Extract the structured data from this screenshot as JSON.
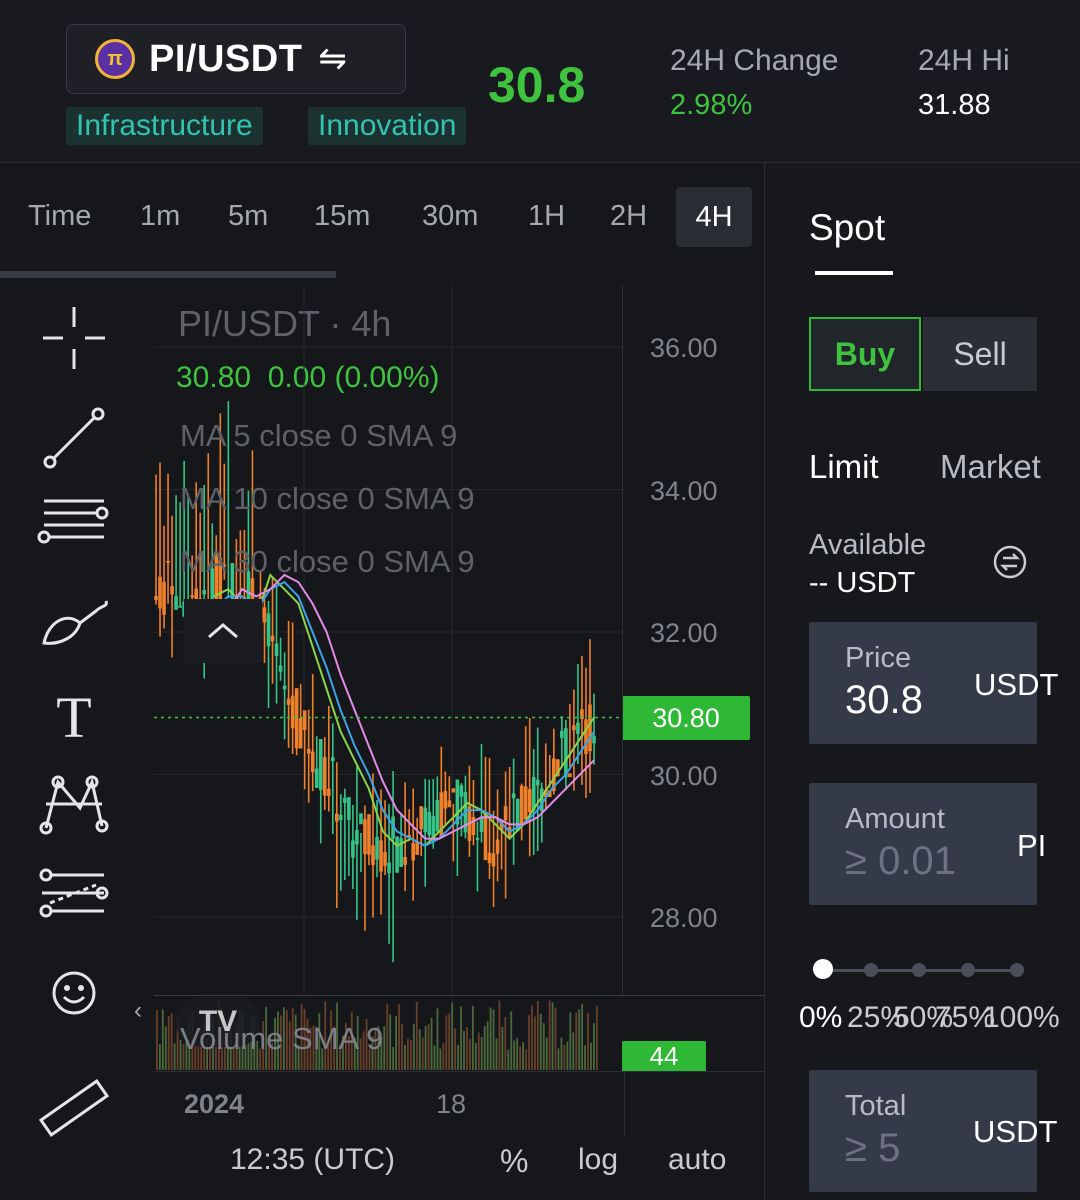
{
  "header": {
    "pair": "PI/USDT",
    "logo_text": "π",
    "swap_icon": "⇋",
    "tags": [
      "Infrastructure",
      "Innovation"
    ],
    "last_price": "30.8",
    "change_label": "24H Change",
    "change_value": "2.98%",
    "high_label": "24H Hi",
    "high_value": "31.88"
  },
  "timeframes": [
    "Time",
    "1m",
    "5m",
    "15m",
    "30m",
    "1H",
    "2H",
    "4H"
  ],
  "active_timeframe": "4H",
  "chart": {
    "title": "PI/USDT · 4h",
    "ohlc": "30.80  0.00 (0.00%)",
    "ma_lines": [
      "MA 5 close 0 SMA 9",
      "MA 10 close 0 SMA 9",
      "MA 30 close 0 SMA 9"
    ],
    "price_labels": [
      "36.00",
      "34.00",
      "32.00",
      "30.00",
      "28.00"
    ],
    "current_price_tag": "30.80",
    "volume_label": "Volume SMA 9",
    "volume_tag": "44",
    "x_labels": [
      "2024",
      "18"
    ],
    "time_zone": "12:35 (UTC)",
    "footer_buttons": [
      "%",
      "log",
      "auto"
    ],
    "collapse_icon": "chevron-up-icon",
    "expand_icon": "‹",
    "watermark": "TV"
  },
  "chart_data": {
    "type": "line",
    "title": "PI/USDT · 4h",
    "xlabel": "",
    "ylabel": "",
    "ylim": [
      27,
      37
    ],
    "x_tick_labels": [
      "2024",
      "18"
    ],
    "y_tick_labels": [
      "36.00",
      "34.00",
      "32.00",
      "30.00",
      "28.00"
    ],
    "grid": true,
    "current_price": 30.8,
    "series": [
      {
        "values": [
          32.5,
          32.6,
          32.4,
          32.2,
          32.8,
          32.6,
          32.4,
          31.8,
          31.2,
          30.6,
          30.2,
          29.8,
          29.2,
          29.0,
          29.1,
          29.0,
          29.2,
          29.4,
          29.6,
          29.5,
          29.3,
          29.1,
          29.3,
          29.6,
          29.9,
          30.2,
          30.5,
          30.8
        ]
      },
      {
        "values": [
          32.3,
          32.5,
          32.5,
          32.3,
          32.6,
          32.7,
          32.5,
          32.0,
          31.5,
          30.9,
          30.4,
          30.0,
          29.5,
          29.2,
          29.1,
          29.0,
          29.1,
          29.3,
          29.5,
          29.5,
          29.4,
          29.2,
          29.3,
          29.5,
          29.8,
          30.0,
          30.3,
          30.6
        ]
      },
      {
        "values": [
          32.0,
          32.3,
          32.6,
          32.5,
          32.6,
          32.8,
          32.7,
          32.4,
          32.0,
          31.4,
          30.9,
          30.4,
          29.9,
          29.5,
          29.3,
          29.1,
          29.1,
          29.2,
          29.3,
          29.4,
          29.4,
          29.3,
          29.3,
          29.4,
          29.6,
          29.8,
          30.0,
          30.2
        ]
      }
    ],
    "colors": {
      "candles_up": "#35c487",
      "candles_down": "#f0802a",
      "ma5": "#8ad44a",
      "ma10": "#3fa2e8",
      "ma30": "#e38ae6",
      "volume": "#6b7a3a"
    }
  },
  "right_panel": {
    "tab": "Spot",
    "buy": "Buy",
    "sell": "Sell",
    "order_types": [
      "Limit",
      "Market"
    ],
    "available_label": "Available",
    "available_value": "-- USDT",
    "price_label": "Price",
    "price_value": "30.8",
    "price_unit": "USDT",
    "amount_label": "Amount",
    "amount_placeholder": "≥ 0.01",
    "amount_unit": "PI",
    "slider_labels": [
      "0%",
      "25%",
      "50%",
      "75%",
      "100%"
    ],
    "slider_value": 0,
    "total_label": "Total",
    "total_placeholder": "≥ 5",
    "total_unit": "USDT"
  },
  "colors": {
    "up": "#3fc33f",
    "teal": "#32c3b1",
    "bg": "#17181c"
  }
}
